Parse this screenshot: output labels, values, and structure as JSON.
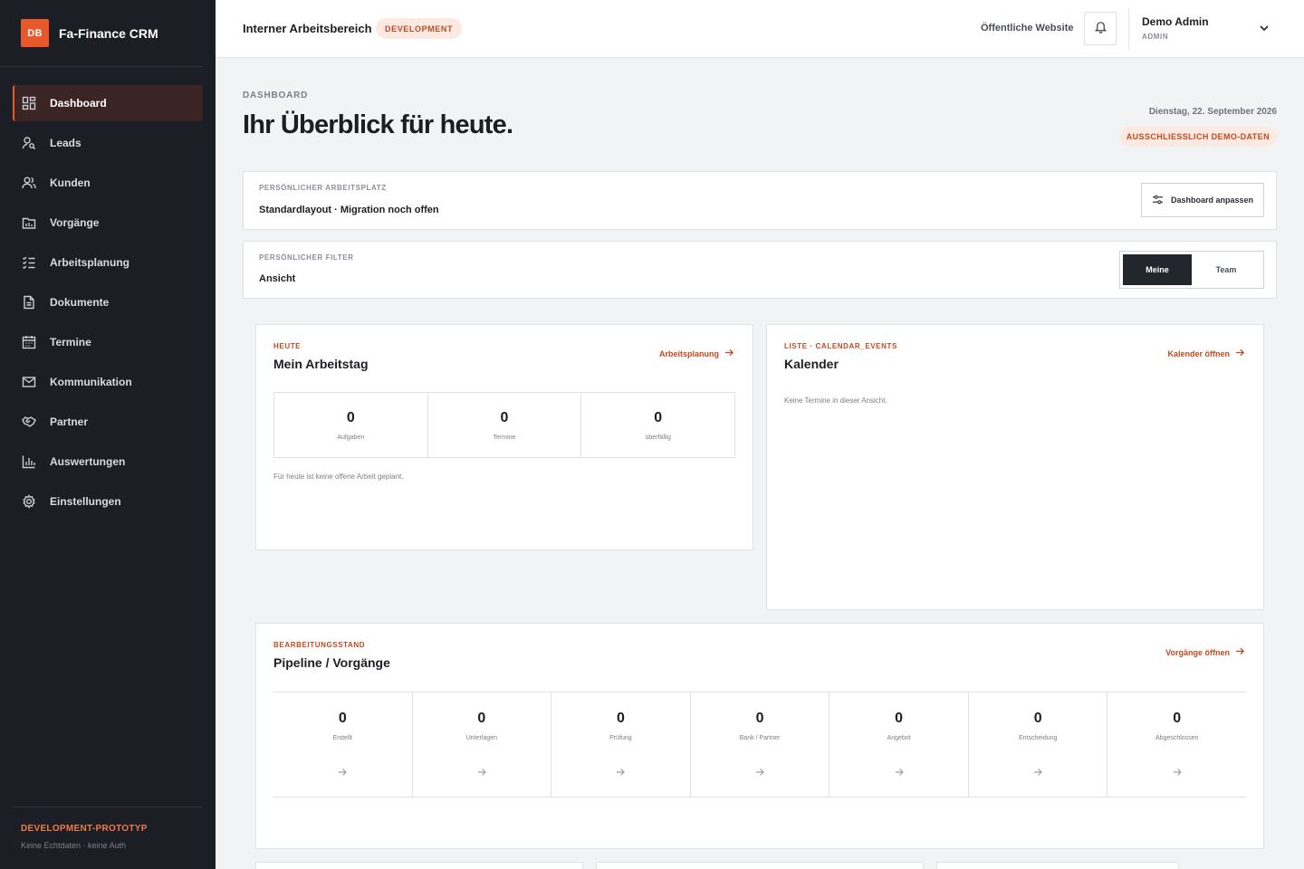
{
  "brand": {
    "logo": "DB",
    "name": "Fa-Finance CRM"
  },
  "nav": [
    {
      "label": "Dashboard",
      "icon": "dashboard-icon",
      "active": true
    },
    {
      "label": "Leads",
      "icon": "user-search-icon"
    },
    {
      "label": "Kunden",
      "icon": "users-icon"
    },
    {
      "label": "Vorgänge",
      "icon": "folder-chart-icon"
    },
    {
      "label": "Arbeitsplanung",
      "icon": "checklist-icon"
    },
    {
      "label": "Dokumente",
      "icon": "document-icon"
    },
    {
      "label": "Termine",
      "icon": "calendar-icon"
    },
    {
      "label": "Kommunikation",
      "icon": "mail-icon"
    },
    {
      "label": "Partner",
      "icon": "handshake-icon"
    },
    {
      "label": "Auswertungen",
      "icon": "bar-chart-icon"
    },
    {
      "label": "Einstellungen",
      "icon": "gear-icon"
    }
  ],
  "sidebar_footer": {
    "title": "DEVELOPMENT-PROTOTYP",
    "subtitle": "Keine Echtdaten · keine Auth"
  },
  "topbar": {
    "workspace": "Interner Arbeitsbereich",
    "env_badge": "DEVELOPMENT",
    "public_link": "Öffentliche Website",
    "user_name": "Demo Admin",
    "user_role": "ADMIN"
  },
  "header": {
    "breadcrumb": "DASHBOARD",
    "title": "Ihr Überblick für heute.",
    "date": "Dienstag, 22. September 2026",
    "demo_badge": "AUSSCHLIESSLICH DEMO-DATEN"
  },
  "workspace_panel": {
    "label": "PERSÖNLICHER ARBEITSPLATZ",
    "value": "Standardlayout · Migration noch offen",
    "button": "Dashboard anpassen"
  },
  "filter_panel": {
    "label": "PERSÖNLICHER FILTER",
    "value": "Ansicht",
    "options": [
      "Meine",
      "Team"
    ],
    "selected": "Meine"
  },
  "workday": {
    "kicker": "HEUTE",
    "title": "Mein Arbeitstag",
    "link": "Arbeitsplanung",
    "stats": [
      {
        "value": "0",
        "label": "Aufgaben"
      },
      {
        "value": "0",
        "label": "Termine"
      },
      {
        "value": "0",
        "label": "überfällig"
      }
    ],
    "note": "Für heute ist keine offene Arbeit geplant."
  },
  "calendar": {
    "kicker": "LISTE · CALENDAR_EVENTS",
    "title": "Kalender",
    "link": "Kalender öffnen",
    "empty": "Keine Termine in dieser Ansicht."
  },
  "pipeline": {
    "kicker": "BEARBEITUNGSSTAND",
    "title": "Pipeline / Vorgänge",
    "link": "Vorgänge öffnen",
    "stages": [
      {
        "value": "0",
        "label": "Erstellt"
      },
      {
        "value": "0",
        "label": "Unterlagen"
      },
      {
        "value": "0",
        "label": "Prüfung"
      },
      {
        "value": "0",
        "label": "Bank / Partner"
      },
      {
        "value": "0",
        "label": "Angebot"
      },
      {
        "value": "0",
        "label": "Entscheidung"
      },
      {
        "value": "0",
        "label": "Abgeschlossen"
      }
    ]
  },
  "colors": {
    "accent": "#e8582a",
    "accent_text": "#c24a20",
    "sidebar_bg": "#1b1e25",
    "page_bg": "#f2f3f5"
  }
}
